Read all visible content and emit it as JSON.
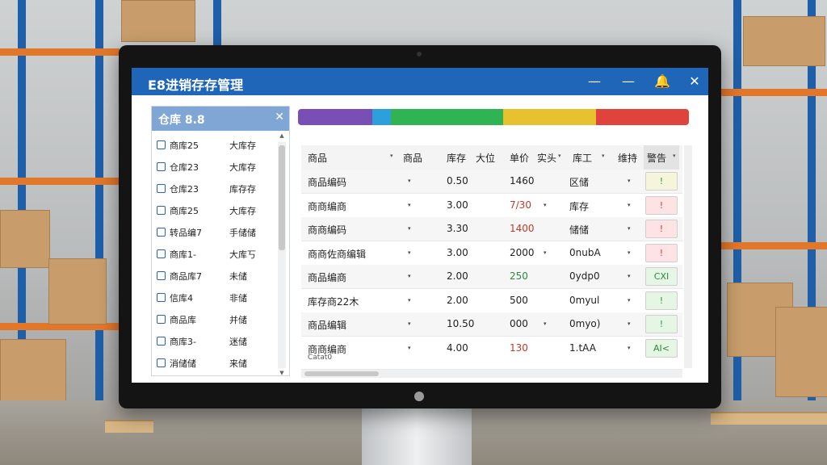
{
  "app": {
    "title": "E8进销存存管理"
  },
  "titlebar": {
    "minimize_icon": "—",
    "bell_icon": "🔔",
    "close_icon": "✕"
  },
  "left_panel": {
    "title": "仓库 8.8",
    "close_icon": "✕",
    "items": [
      {
        "name": "商库25",
        "value": "大库存"
      },
      {
        "name": "仓库23",
        "value": "大库存"
      },
      {
        "name": "仓库23",
        "value": "库存存"
      },
      {
        "name": "商库25",
        "value": "大库存"
      },
      {
        "name": "转品编7",
        "value": "手储储"
      },
      {
        "name": "商库1-",
        "value": "大库丂"
      },
      {
        "name": "商品库7",
        "value": "未储"
      },
      {
        "name": "信库4",
        "value": "非储"
      },
      {
        "name": "商品库",
        "value": "并储"
      },
      {
        "name": "商库3-",
        "value": "迷储"
      },
      {
        "name": "消储储",
        "value": "来储"
      }
    ]
  },
  "band_colors": [
    "#7a4fb5",
    "#2d9fdb",
    "#2fb353",
    "#e7c22f",
    "#e0433b"
  ],
  "table": {
    "headers": [
      "商品",
      "商品",
      "库存",
      "大位",
      "单价",
      "实头",
      "库工",
      "维持",
      "警告"
    ],
    "rows": [
      {
        "name": "商品编码",
        "qty": "0.50",
        "val": "1460",
        "val_color": "#222222",
        "code": "区储",
        "status": "!",
        "status_color": "#2b9a3e",
        "pill_bg": "#f5f5dc",
        "caret1": "▾",
        "caret2": ""
      },
      {
        "name": "商商编商",
        "qty": "3.00",
        "val": "7/30",
        "val_color": "#c0392b",
        "code": "库存",
        "status": "!",
        "status_color": "#d43b32",
        "pill_bg": "#fde3e3",
        "caret1": "▾",
        "caret2": "▾"
      },
      {
        "name": "商商编码",
        "qty": "3.30",
        "val": "1400",
        "val_color": "#c0392b",
        "code": "储储",
        "status": "!",
        "status_color": "#d43b32",
        "pill_bg": "#fde3e3",
        "caret1": "▾",
        "caret2": ""
      },
      {
        "name": "商商佐商编辑",
        "qty": "3.00",
        "val": "2000",
        "val_color": "#222222",
        "code": "0nubA",
        "status": "!",
        "status_color": "#d43b32",
        "pill_bg": "#fde3e3",
        "caret1": "▾",
        "caret2": "▾"
      },
      {
        "name": "商品编商",
        "qty": "2.00",
        "val": "250",
        "val_color": "#2b8a3e",
        "code": "0ydp0",
        "status": "CXI",
        "status_color": "#2b8a3e",
        "pill_bg": "#e5f6e5",
        "caret1": "▾",
        "caret2": ""
      },
      {
        "name": "库存商22木",
        "qty": "2.00",
        "val": "500",
        "val_color": "#222222",
        "code": "0myul",
        "status": "!",
        "status_color": "#2b9a3e",
        "pill_bg": "#e5f6e5",
        "caret1": "▾",
        "caret2": ""
      },
      {
        "name": "商品编辑",
        "qty": "10.50",
        "val": "000",
        "val_color": "#222222",
        "code": "0myo)",
        "status": "!",
        "status_color": "#2b9a3e",
        "pill_bg": "#e5f6e5",
        "caret1": "▾",
        "caret2": "▾"
      },
      {
        "name": "商商编商",
        "sub": "Catat0",
        "qty": "4.00",
        "val": "130",
        "val_color": "#c0392b",
        "code": "1.tAA",
        "status": "AI<",
        "status_color": "#2b8a3e",
        "pill_bg": "#e5f6e5",
        "caret1": "▾",
        "caret2": ""
      }
    ]
  }
}
